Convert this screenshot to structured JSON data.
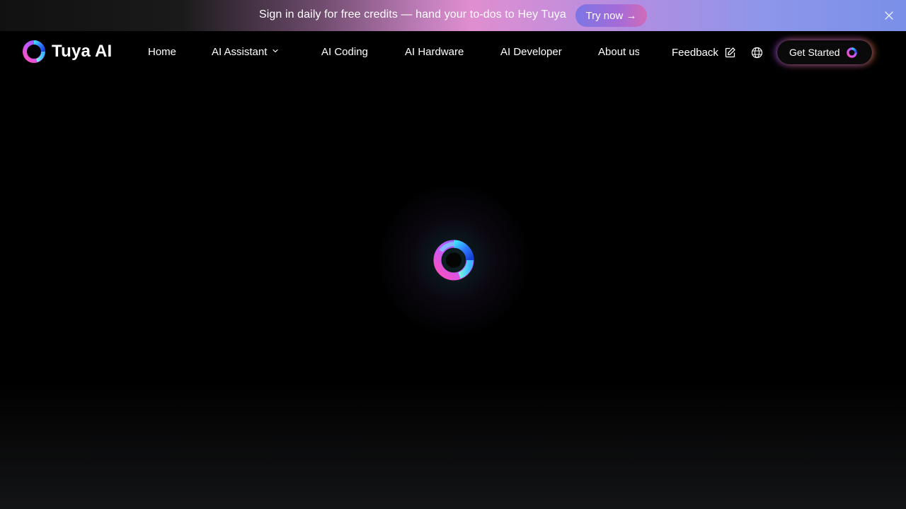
{
  "banner": {
    "message": "Sign in daily for free credits — hand your to-dos to Hey Tuya",
    "cta_label": "Try now →",
    "close_icon": "close-icon"
  },
  "nav": {
    "brand": "Tuya AI",
    "items": [
      {
        "label": "Home"
      },
      {
        "label": "AI Assistant",
        "has_dropdown": true
      },
      {
        "label": "AI Coding"
      },
      {
        "label": "AI Hardware"
      },
      {
        "label": "AI Developer"
      },
      {
        "label": "About us"
      }
    ],
    "feedback_label": "Feedback",
    "feedback_icon": "edit-icon",
    "language_icon": "globe-icon",
    "cta_label": "Get Started"
  },
  "loader": {
    "icon": "tuya-orb-icon"
  },
  "colors": {
    "background": "#000000",
    "banner_accent": "#e08ed0",
    "banner_end": "#7a8fe8",
    "try_button": "#a46bd8"
  }
}
